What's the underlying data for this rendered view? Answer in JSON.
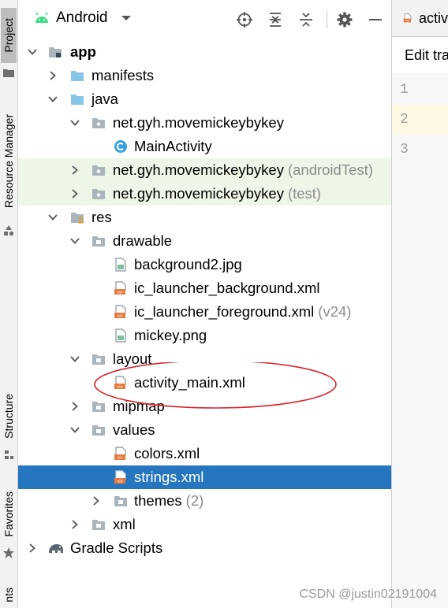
{
  "sidebar": {
    "tabs": [
      {
        "label": "Project"
      },
      {
        "label": "Resource Manager"
      },
      {
        "label": "Structure"
      },
      {
        "label": "Favorites"
      },
      {
        "label": "nts"
      }
    ]
  },
  "toolbar": {
    "view_label": "Android",
    "buttons": [
      "locate-icon",
      "expand-all-icon",
      "collapse-all-icon",
      "gear-icon",
      "minimize-icon"
    ]
  },
  "tree": [
    {
      "label": "app",
      "suffix": ""
    },
    {
      "label": "manifests",
      "suffix": ""
    },
    {
      "label": "java",
      "suffix": ""
    },
    {
      "label": "net.gyh.movemickeybykey",
      "suffix": ""
    },
    {
      "label": "MainActivity",
      "suffix": ""
    },
    {
      "label": "net.gyh.movemickeybykey",
      "suffix": "(androidTest)"
    },
    {
      "label": "net.gyh.movemickeybykey",
      "suffix": "(test)"
    },
    {
      "label": "res",
      "suffix": ""
    },
    {
      "label": "drawable",
      "suffix": ""
    },
    {
      "label": "background2.jpg",
      "suffix": ""
    },
    {
      "label": "ic_launcher_background.xml",
      "suffix": ""
    },
    {
      "label": "ic_launcher_foreground.xml",
      "suffix": "(v24)"
    },
    {
      "label": "mickey.png",
      "suffix": ""
    },
    {
      "label": "layout",
      "suffix": ""
    },
    {
      "label": "activity_main.xml",
      "suffix": ""
    },
    {
      "label": "mipmap",
      "suffix": ""
    },
    {
      "label": "values",
      "suffix": ""
    },
    {
      "label": "colors.xml",
      "suffix": ""
    },
    {
      "label": "strings.xml",
      "suffix": ""
    },
    {
      "label": "themes",
      "suffix": "(2)"
    },
    {
      "label": "xml",
      "suffix": ""
    },
    {
      "label": "Gradle Scripts",
      "suffix": ""
    }
  ],
  "editor": {
    "tab_label": "activ",
    "edit_bar_text": "Edit tra",
    "line_numbers": [
      "1",
      "2",
      "3"
    ]
  },
  "watermark": "CSDN @justin02191004",
  "colors": {
    "selection": "#2675bf",
    "folder_blue": "#87c5e8",
    "xml_orange": "#e87a3c",
    "annotation_red": "#d9232a",
    "green_row": "#eef6e8"
  }
}
